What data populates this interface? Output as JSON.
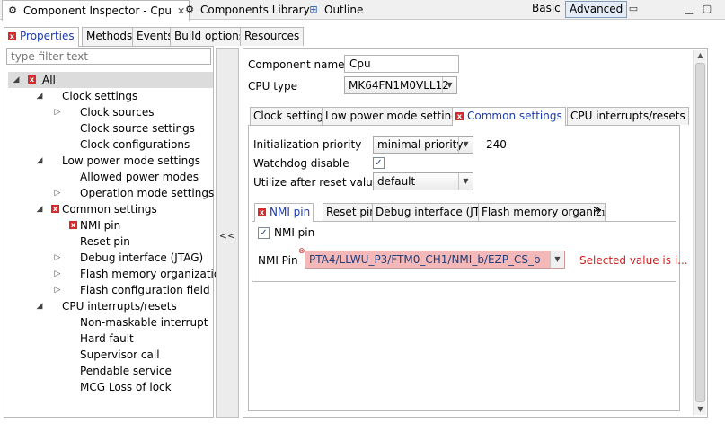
{
  "view_tabs": [
    {
      "label": "Component Inspector - Cpu",
      "icon": "component-inspector-icon",
      "active": true,
      "closable": true
    },
    {
      "label": "Components Library",
      "icon": "components-library-icon",
      "active": false
    },
    {
      "label": "Outline",
      "icon": "outline-icon",
      "active": false
    }
  ],
  "mode": {
    "basic": "Basic",
    "advanced": "Advanced"
  },
  "sub_tabs": [
    "Properties",
    "Methods",
    "Events",
    "Build options",
    "Resources"
  ],
  "filter": {
    "placeholder": "type filter text"
  },
  "tree": [
    {
      "label": "All",
      "level": 0,
      "twist": "expanded",
      "error": true
    },
    {
      "label": "Clock settings",
      "level": 1,
      "twist": "expanded"
    },
    {
      "label": "Clock sources",
      "level": 2,
      "twist": "collapsed"
    },
    {
      "label": "Clock source settings",
      "level": 2,
      "twist": "none"
    },
    {
      "label": "Clock configurations",
      "level": 2,
      "twist": "none"
    },
    {
      "label": "Low power mode settings",
      "level": 1,
      "twist": "expanded"
    },
    {
      "label": "Allowed power modes",
      "level": 2,
      "twist": "none"
    },
    {
      "label": "Operation mode settings",
      "level": 2,
      "twist": "collapsed"
    },
    {
      "label": "Common settings",
      "level": 1,
      "twist": "expanded",
      "error": true
    },
    {
      "label": "NMI pin",
      "level": 2,
      "twist": "none",
      "error": true
    },
    {
      "label": "Reset pin",
      "level": 2,
      "twist": "none"
    },
    {
      "label": "Debug interface (JTAG)",
      "level": 2,
      "twist": "collapsed"
    },
    {
      "label": "Flash memory organization",
      "level": 2,
      "twist": "collapsed"
    },
    {
      "label": "Flash configuration field",
      "level": 2,
      "twist": "collapsed"
    },
    {
      "label": "CPU interrupts/resets",
      "level": 1,
      "twist": "expanded"
    },
    {
      "label": "Non-maskable interrupt",
      "level": 2,
      "twist": "none"
    },
    {
      "label": "Hard fault",
      "level": 2,
      "twist": "none"
    },
    {
      "label": "Supervisor call",
      "level": 2,
      "twist": "none"
    },
    {
      "label": "Pendable service",
      "level": 2,
      "twist": "none"
    },
    {
      "label": "MCG Loss of lock",
      "level": 2,
      "twist": "none"
    }
  ],
  "splitter": {
    "collapse_label": "<<"
  },
  "component": {
    "name_label": "Component name",
    "name_value": "Cpu",
    "cpu_type_label": "CPU type",
    "cpu_type_value": "MK64FN1M0VLL12"
  },
  "settings_tabs": [
    "Clock settings",
    "Low power mode settings",
    "Common settings",
    "CPU interrupts/resets"
  ],
  "common": {
    "init_priority_label": "Initialization priority",
    "init_priority_value": "minimal priority",
    "init_priority_number": "240",
    "watchdog_label": "Watchdog disable",
    "watchdog_checked": true,
    "utilize_label": "Utilize after reset values",
    "utilize_value": "default"
  },
  "common_tabs": [
    "NMI pin",
    "Reset pin",
    "Debug interface (JTA",
    "Flash memory organiz"
  ],
  "more_tabs": {
    "chevron": "»",
    "count": "1"
  },
  "nmi": {
    "checkbox_label": "NMI pin",
    "checked": true,
    "pin_label": "NMI Pin",
    "pin_value": "PTA4/LLWU_P3/FTM0_CH1/NMI_b/EZP_CS_b",
    "error_message": "Selected value is i..."
  },
  "colors": {
    "error": "#d42c2c",
    "link": "#1a3bb0",
    "error_field": "#f4b8b8"
  }
}
